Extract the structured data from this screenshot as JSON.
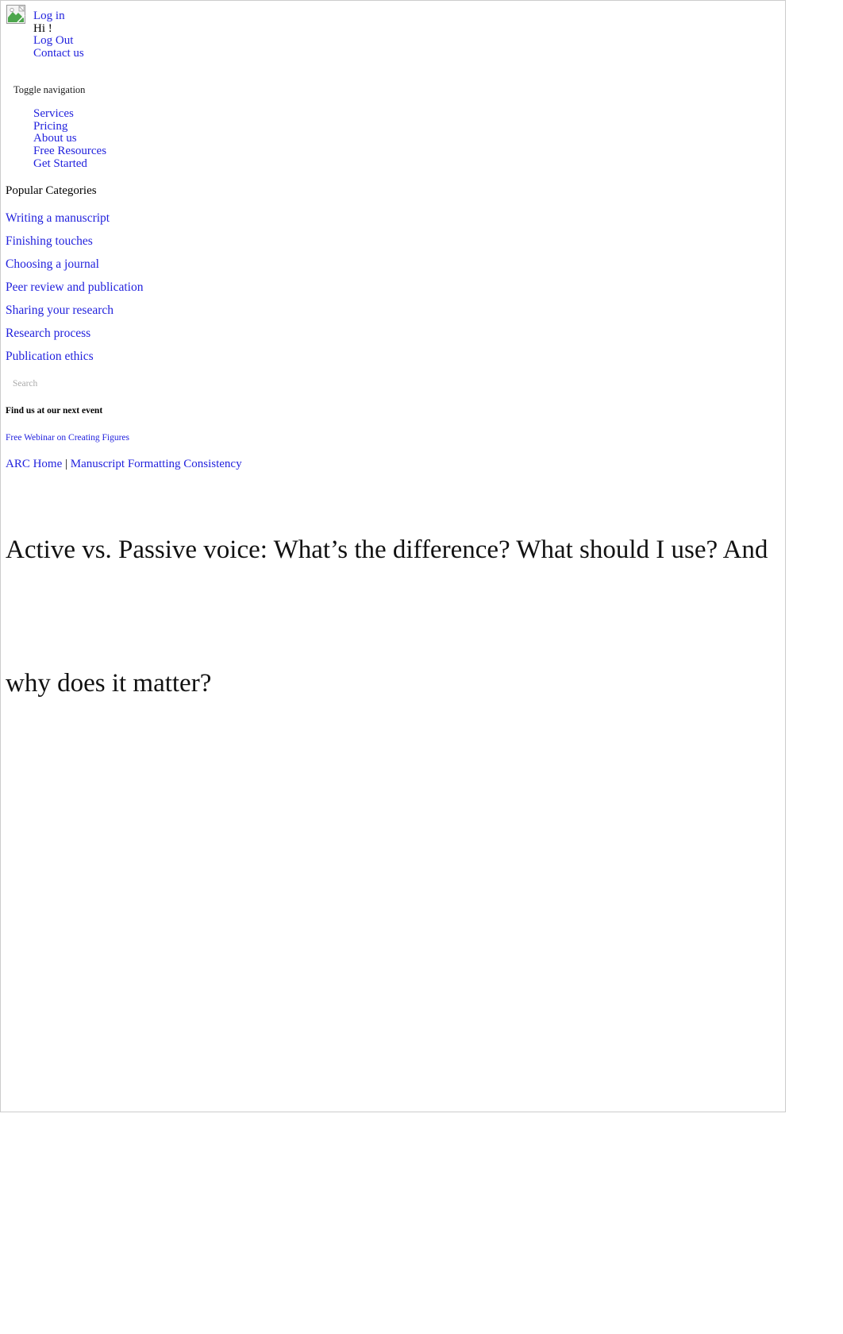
{
  "utility_bar": {
    "logo_icon": "broken-image-icon",
    "items": [
      {
        "label": "Log in",
        "type": "link"
      },
      {
        "label": "Hi !",
        "type": "text"
      },
      {
        "label": "Log Out",
        "type": "link"
      },
      {
        "label": "Contact us",
        "type": "link"
      }
    ]
  },
  "navbar": {
    "toggle_label": "Toggle navigation",
    "items": [
      {
        "label": "Services"
      },
      {
        "label": "Pricing"
      },
      {
        "label": "About us"
      },
      {
        "label": "Free Resources"
      },
      {
        "label": "Get Started"
      }
    ]
  },
  "sidebar": {
    "categories_heading": "Popular Categories",
    "categories": [
      {
        "label": "Writing a manuscript"
      },
      {
        "label": "Finishing touches"
      },
      {
        "label": "Choosing a journal"
      },
      {
        "label": "Peer review and publication"
      },
      {
        "label": "Sharing your research"
      },
      {
        "label": "Research process"
      },
      {
        "label": "Publication ethics"
      }
    ],
    "event_heading": "Find us at our next event",
    "event_link": "Free Webinar on Creating Figures"
  },
  "search": {
    "placeholder": "Search",
    "value": ""
  },
  "breadcrumb": {
    "home": "ARC Home",
    "separator": "|",
    "current": "Manuscript Formatting Consistency"
  },
  "article": {
    "title": "Active vs. Passive voice: What’s the difference? What should I use? And why does it matter?"
  },
  "colors": {
    "link": "#2222dd",
    "text": "#000000",
    "border": "#cccccc",
    "placeholder": "#aaaaaa"
  }
}
